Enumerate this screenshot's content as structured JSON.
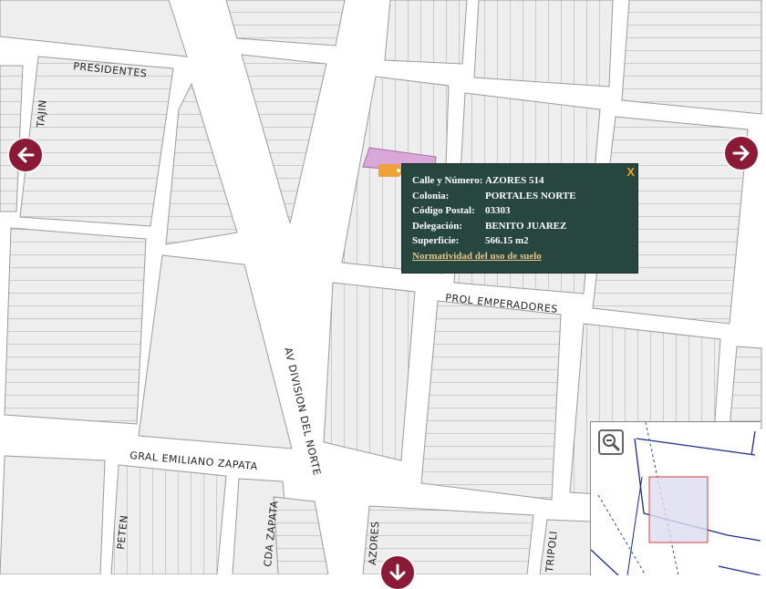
{
  "streets": {
    "presidentes": "PRESIDENTES",
    "tajin": "TAJIN",
    "av_division_del_norte": "AV DIVISION DEL NORTE",
    "prol_emperadores": "PROL EMPERADORES",
    "gral_emiliano_zapata": "GRAL EMILIANO ZAPATA",
    "peten": "PETEN",
    "cda_zapata": "CDA ZAPATA",
    "azores": "AZORES",
    "tripoli": "TRIPOLI"
  },
  "popup": {
    "rows": [
      {
        "label": "Calle y Número:",
        "value": "AZORES 514"
      },
      {
        "label": "Colonia:",
        "value": "PORTALES NORTE"
      },
      {
        "label": "Código Postal:",
        "value": "03303"
      },
      {
        "label": "Delegación:",
        "value": "BENITO JUAREZ"
      },
      {
        "label": "Superficie:",
        "value": "566.15 m2"
      }
    ],
    "link": "Normatividad del uso de suelo",
    "close": "X"
  },
  "colors": {
    "block_fill": "#eeeeee",
    "block_stroke": "#9a9a9a",
    "selected_parcel": "#d9a8d9",
    "popup_bg": "#27463e",
    "nav_arrow": "#8a1a36",
    "marker": "#f2a03a",
    "overview_box_fill": "#dcdcf0",
    "overview_box_stroke": "#d04040",
    "overview_lines": "#1a2a8a"
  },
  "icons": {
    "left": "arrow-left-icon",
    "right": "arrow-right-icon",
    "down": "arrow-down-icon",
    "zoom": "zoom-out-icon",
    "marker": "tag-marker-icon"
  }
}
